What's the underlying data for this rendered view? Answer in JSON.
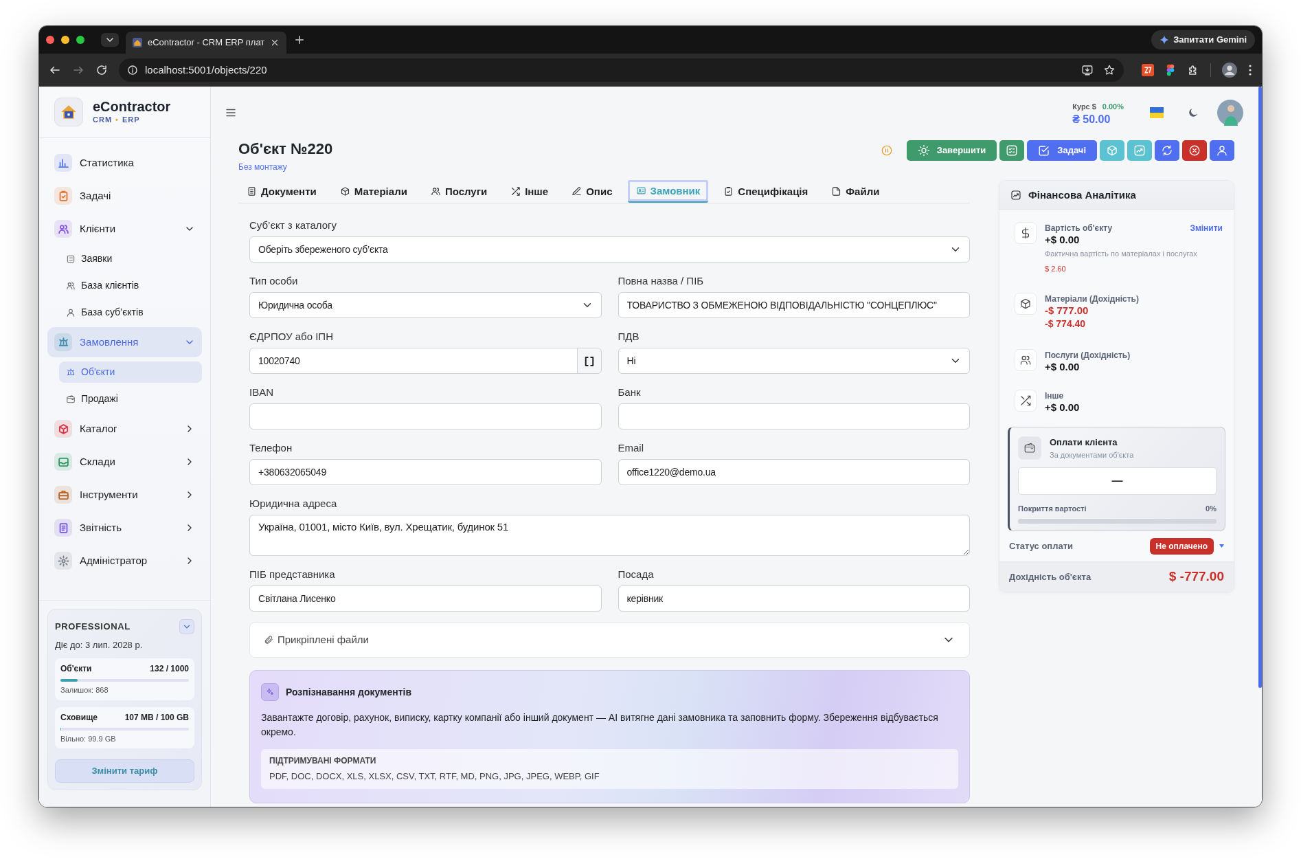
{
  "browser": {
    "tab_title": "eContractor - CRM ERP плат",
    "url": "localhost:5001/objects/220",
    "gemini_button": "Запитати Gemini"
  },
  "sidebar": {
    "brand": "eContractor",
    "tagline": [
      "CRM",
      "•",
      "ERP"
    ],
    "items": [
      {
        "label": "Статистика",
        "kind": "link",
        "color": "#5b7be0",
        "selected": false
      },
      {
        "label": "Задачі",
        "kind": "link",
        "color": "#e0773a",
        "selected": false
      },
      {
        "label": "Клієнти",
        "kind": "group",
        "color": "#8a5ae0",
        "selected": false,
        "expanded": true,
        "children": [
          {
            "label": "Заявки",
            "selected": false
          },
          {
            "label": "База клієнтів",
            "selected": false
          },
          {
            "label": "База суб’єктів",
            "selected": false
          }
        ]
      },
      {
        "label": "Замовлення",
        "kind": "group",
        "color": "#3f8fb0",
        "selected": true,
        "expanded": true,
        "children": [
          {
            "label": "Об'єкти",
            "selected": true
          },
          {
            "label": "Продажі",
            "selected": false
          }
        ]
      },
      {
        "label": "Каталог",
        "kind": "group",
        "color": "#d8384a",
        "selected": false,
        "expanded": false
      },
      {
        "label": "Склади",
        "kind": "group",
        "color": "#2f9a63",
        "selected": false,
        "expanded": false
      },
      {
        "label": "Інструменти",
        "kind": "group",
        "color": "#b8662a",
        "selected": false,
        "expanded": false
      },
      {
        "label": "Звітність",
        "kind": "group",
        "color": "#7a5ad8",
        "selected": false,
        "expanded": false
      },
      {
        "label": "Адміністратор",
        "kind": "group",
        "color": "#7a808a",
        "selected": false,
        "expanded": false
      }
    ],
    "plan": {
      "name": "PROFESSIONAL",
      "valid_until": "Діє до: 3 лип. 2028 р.",
      "quotas": [
        {
          "label": "Об'єкти",
          "value": "132 / 1000",
          "level": 0.132,
          "note": "Залишок: 868"
        },
        {
          "label": "Сховище",
          "value": "107 MB / 100 GB",
          "level": 0.001,
          "note": "Вільно: 99.9 GB"
        }
      ],
      "button": "Змінити тариф"
    }
  },
  "header": {
    "rate_label": "Курс $",
    "rate_change": "0.00%",
    "rate_value": "₴ 50.00"
  },
  "page": {
    "title": "Об'єкт №220",
    "subtitle": "Без монтажу",
    "actions": [
      {
        "label": "Завершити",
        "color": "#3f9a6c"
      },
      {
        "color": "#3f9a6c"
      },
      {
        "label": "Задачі",
        "color": "#4f6ef0"
      },
      {
        "color": "#5bc2d2"
      },
      {
        "color": "#5bc2d2"
      },
      {
        "color": "#4f6ef0"
      },
      {
        "color": "#c9302a"
      },
      {
        "color": "#4f6ef0"
      }
    ]
  },
  "tabs": [
    {
      "label": "Документи",
      "selected": false
    },
    {
      "label": "Матеріали",
      "selected": false
    },
    {
      "label": "Послуги",
      "selected": false
    },
    {
      "label": "Інше",
      "selected": false
    },
    {
      "label": "Опис",
      "selected": false
    },
    {
      "label": "Замовник",
      "selected": true
    },
    {
      "label": "Специфікація",
      "selected": false
    },
    {
      "label": "Файли",
      "selected": false
    }
  ],
  "form": {
    "rows": [
      [
        {
          "kind": "select",
          "label": "Суб’єкт з каталогу",
          "value": "Оберіть збереженого суб’єкта"
        }
      ],
      [
        {
          "kind": "select",
          "label": "Тип особи",
          "value": "Юридична особа"
        },
        {
          "kind": "input",
          "label": "Повна назва / ПІБ",
          "value": "ТОВАРИСТВО З ОБМЕЖЕНОЮ ВІДПОВІДАЛЬНІСТЮ \"СОНЦЕПЛЮС\""
        }
      ],
      [
        {
          "kind": "scan",
          "label": "ЄДРПОУ або ІПН",
          "value": "10020740"
        },
        {
          "kind": "select",
          "label": "ПДВ",
          "value": "Ні"
        }
      ],
      [
        {
          "kind": "input",
          "label": "IBAN"
        },
        {
          "kind": "input",
          "label": "Банк"
        }
      ],
      [
        {
          "kind": "input",
          "label": "Телефон",
          "value": "+380632065049"
        },
        {
          "kind": "input",
          "label": "Email",
          "value": "office1220@demo.ua"
        }
      ],
      [
        {
          "kind": "textarea",
          "label": "Юридична адреса",
          "value": "Україна, 01001, місто Київ, вул. Хрещатик, будинок 51"
        }
      ],
      [
        {
          "kind": "input",
          "label": "ПІБ представника",
          "value": "Світлана Лисенко"
        },
        {
          "kind": "input",
          "label": "Посада",
          "value": "керівник"
        }
      ]
    ],
    "attachments": {
      "label": "Прикріплені файли",
      "expanded": false
    },
    "recognition": {
      "title": "Розпізнавання документів",
      "text": "Завантажте договір, рахунок, виписку, картку компанії або інший документ — AI витягне дані замовника та заповнить форму. Збереження відбувається окремо.",
      "formats_label": "ПІДТРИМУВАНІ ФОРМАТИ",
      "formats": "PDF, DOC, DOCX, XLS, XLSX, CSV, TXT, RTF, MD, PNG, JPG, JPEG, WEBP, GIF"
    }
  },
  "finance": {
    "title": "Фінансова Аналітика",
    "items": [
      {
        "label": "Вартість об'єкту",
        "value": "+$ 0.00",
        "negative": false,
        "action": "Змінити",
        "note": "Фактична вартість по матеріалах і послугах",
        "extra": "$ 2.60"
      },
      {
        "label": "Матеріали (Дохідність)",
        "value": "-$ 777.00",
        "negative": true,
        "extra": "-$ 774.40"
      },
      {
        "label": "Послуги (Дохідність)",
        "value": "+$ 0.00",
        "negative": false
      },
      {
        "label": "Інше",
        "value": "+$ 0.00",
        "negative": false
      }
    ],
    "payments": {
      "title": "Оплати клієнта",
      "subtitle": "За документами об'єкта",
      "amount": "—",
      "coverage_label": "Покриття вартості",
      "coverage_value": "0%",
      "level": 0
    },
    "status": {
      "label": "Статус оплати",
      "value": "Не оплачено"
    },
    "profit": {
      "label": "Дохідність об'єкта",
      "value": "$ -777.00"
    }
  }
}
